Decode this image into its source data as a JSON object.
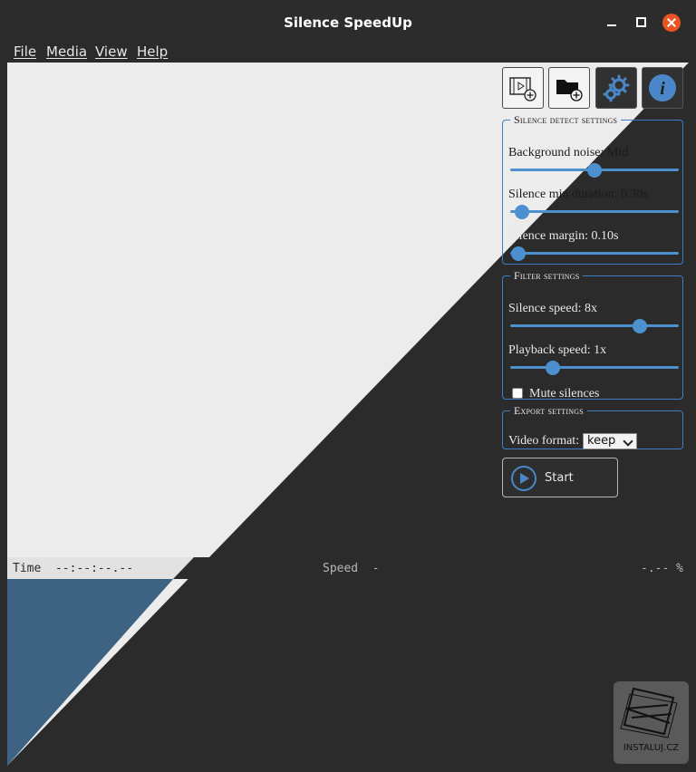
{
  "window": {
    "title": "Silence SpeedUp",
    "controls": [
      "minimize-icon",
      "maximize-icon",
      "close-icon"
    ],
    "close_color": "#e95420"
  },
  "menu": [
    "File",
    "Media",
    "View",
    "Help"
  ],
  "toolbar": {
    "buttons": [
      "add-video-icon",
      "add-folder-icon",
      "settings-gear-icon",
      "info-icon"
    ]
  },
  "silence_detect": {
    "title": "Silence detect settings",
    "background_noise_label": "Background noise: Mid",
    "background_noise_value": 0.5,
    "min_duration_label": "Silence min duration: 0.30s",
    "min_duration_value": 0.07,
    "margin_label": "Silence margin: 0.10s",
    "margin_value": 0.05
  },
  "filter": {
    "title": "Filter settings",
    "silence_speed_label": "Silence speed: 8x",
    "silence_speed_value": 0.77,
    "playback_speed_label": "Playback speed: 1x",
    "playback_speed_value": 0.25,
    "mute_label": "Mute silences",
    "mute_checked": false
  },
  "export": {
    "title": "Export settings",
    "format_label": "Video format:",
    "format_value": "keep"
  },
  "start_label": "Start",
  "status": {
    "time": "Time  --:--:--.--",
    "speed": "Speed  -",
    "percent": "-.-- %"
  },
  "watermark_text": "INSTALUJ.CZ",
  "colors": {
    "accent": "#4c90cf",
    "light_bg": "#ececec",
    "dark_bg": "#2b2b2b",
    "blue_corner": "#3d6282"
  }
}
